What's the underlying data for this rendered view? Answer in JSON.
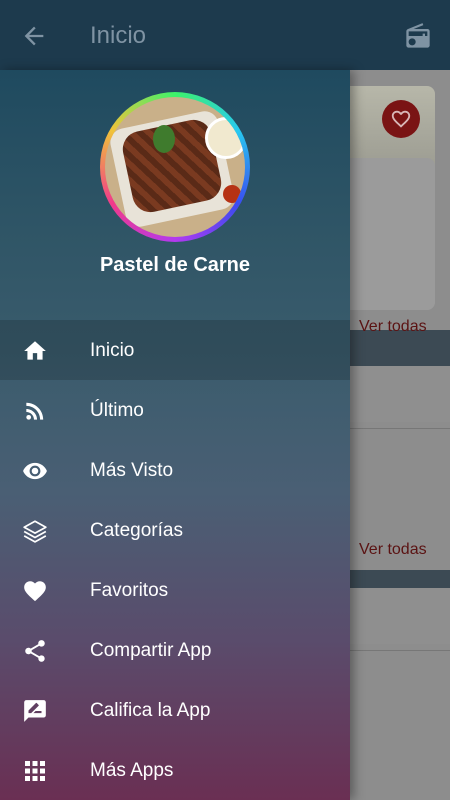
{
  "appbar": {
    "title": "Inicio",
    "back_icon": "arrow-back-icon",
    "radio_icon": "radio-icon"
  },
  "background": {
    "see_all_1": "Ver todas",
    "see_all_2": "Ver todas",
    "favorite_icon": "heart-icon"
  },
  "drawer": {
    "header_title": "Pastel de Carne",
    "items": [
      {
        "label": "Inicio",
        "icon": "home-icon",
        "active": true
      },
      {
        "label": "Último",
        "icon": "rss-icon"
      },
      {
        "label": "Más Visto",
        "icon": "eye-icon"
      },
      {
        "label": "Categorías",
        "icon": "layers-icon"
      },
      {
        "label": "Favoritos",
        "icon": "heart-icon"
      },
      {
        "label": "Compartir App",
        "icon": "share-icon"
      },
      {
        "label": "Califica la App",
        "icon": "rate-review-icon"
      },
      {
        "label": "Más Apps",
        "icon": "apps-grid-icon"
      }
    ]
  },
  "colors": {
    "appbar": "#1d3a4d",
    "accent_red": "#7a1414",
    "drawer_top": "#1f4a5f",
    "drawer_bottom": "#6a2f53"
  }
}
